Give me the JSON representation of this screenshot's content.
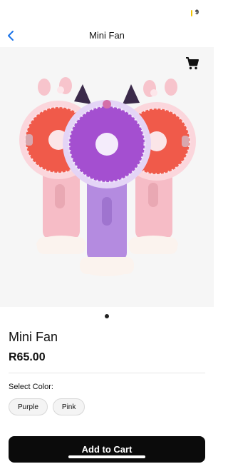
{
  "status_bar": {
    "battery_text": "9"
  },
  "nav": {
    "title": "Mini Fan"
  },
  "product": {
    "name": "Mini Fan",
    "price": "R65.00",
    "select_color_label": "Select Color:",
    "colors": [
      "Purple",
      "Pink"
    ],
    "image_count": 1,
    "active_image_index": 0
  },
  "actions": {
    "add_to_cart_label": "Add to Cart"
  },
  "colors": {
    "accent_blue": "#1a73e8",
    "button_bg": "#0b0b0b",
    "fan_pink": "#f4b9c3",
    "fan_purple": "#b58ee0"
  },
  "icons": {
    "back": "chevron-left-icon",
    "cart": "cart-icon"
  }
}
